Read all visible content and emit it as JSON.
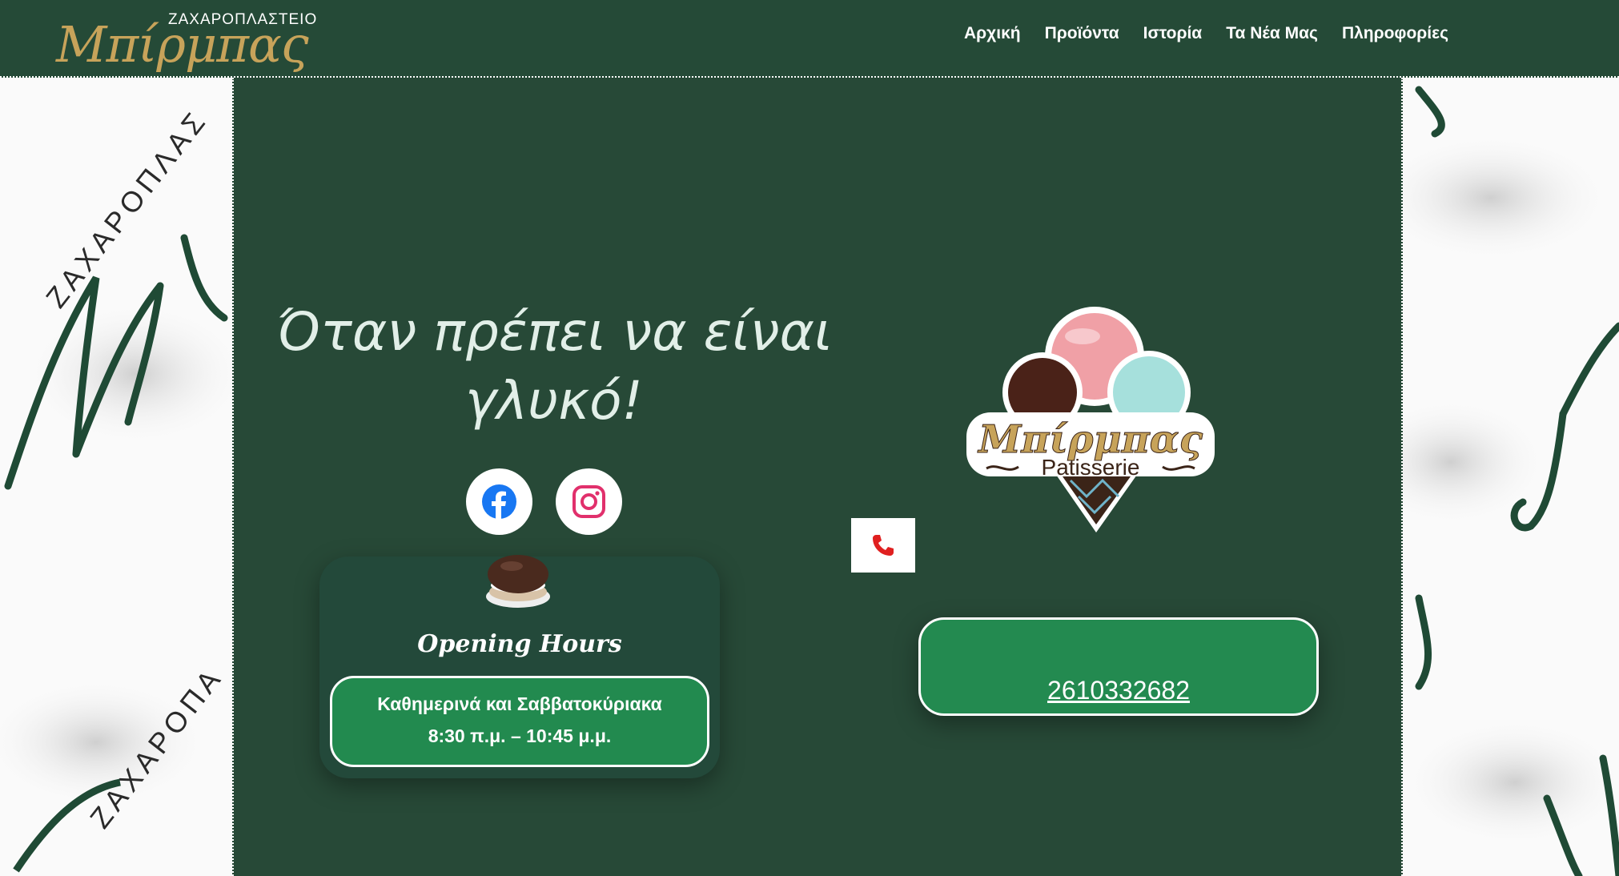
{
  "header": {
    "logo_subtitle": "ΖΑΧΑΡΟΠΛΑΣΤΕΙΟ",
    "logo_title": "Μπίρμπας",
    "nav": [
      {
        "label": "Αρχική"
      },
      {
        "label": "Προϊόντα"
      },
      {
        "label": "Ιστορία"
      },
      {
        "label": "Τα Νέα Μας"
      },
      {
        "label": "Πληροφορίες"
      }
    ]
  },
  "hero": {
    "headline_line1": "Όταν πρέπει να είναι",
    "headline_line2": "γλυκό!"
  },
  "social": {
    "facebook_icon": "facebook-icon",
    "instagram_icon": "instagram-icon"
  },
  "opening_hours": {
    "title": "Opening Hours",
    "line1": "Καθημερινά και Σαββατοκύριακα",
    "line2": "8:30 π.μ. – 10:45 μ.μ."
  },
  "brand_logo": {
    "title": "Μπίρμπας",
    "subtitle": "Patisserie"
  },
  "contact": {
    "phone_icon": "phone-icon",
    "phone": "2610332682"
  },
  "colors": {
    "header_bg": "#254a37",
    "panel_bg": "#274937",
    "card_green": "#228a4f",
    "gold": "#c7a35a"
  }
}
